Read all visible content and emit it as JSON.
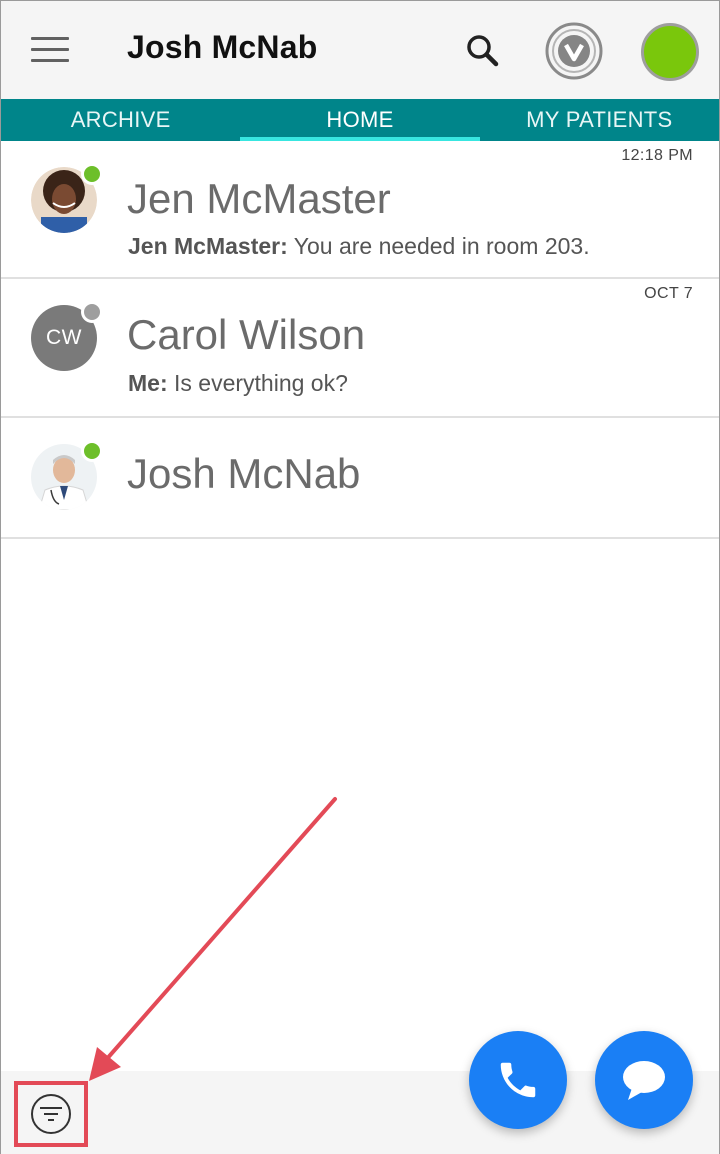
{
  "header": {
    "menu_icon": "hamburger-menu-icon",
    "title": "Josh McNab",
    "search_icon": "search-icon",
    "vocera_icon": "vocera-badge-icon",
    "status_color": "#7ac70c"
  },
  "tabs": [
    {
      "label": "ARCHIVE",
      "active": false
    },
    {
      "label": "HOME",
      "active": true
    },
    {
      "label": "MY PATIENTS",
      "active": false
    }
  ],
  "conversations": [
    {
      "name": "Jen McMaster",
      "time": "12:18 PM",
      "preview_sender": "Jen McMaster:",
      "preview_text": " You are needed in room 203.",
      "presence_color": "#6dbf2a",
      "avatar": "photo"
    },
    {
      "name": "Carol Wilson",
      "time": "OCT 7",
      "preview_sender": "Me:",
      "preview_text": " Is everything ok?",
      "presence_color": "#9e9e9e",
      "avatar_initials": "CW"
    },
    {
      "name": "Josh McNab",
      "time": "",
      "preview_sender": "",
      "preview_text": "",
      "presence_color": "#6dbf2a",
      "avatar": "photo"
    }
  ],
  "actions": {
    "call_icon": "phone-icon",
    "message_icon": "chat-bubble-icon",
    "filter_icon": "filter-icon",
    "accent": "#1a7ff5",
    "annotation_color": "#e34a57"
  }
}
